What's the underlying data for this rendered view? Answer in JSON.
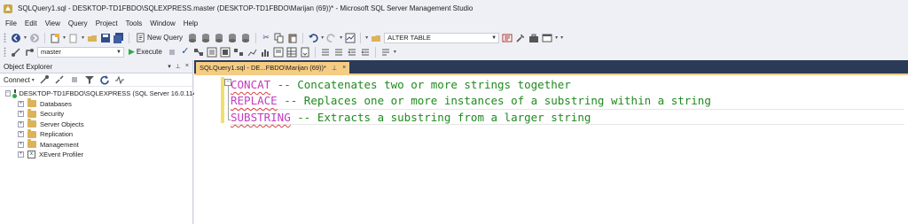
{
  "window": {
    "title": "SQLQuery1.sql - DESKTOP-TD1FBDO\\SQLEXPRESS.master (DESKTOP-TD1FBDO\\Marijan (69))* - Microsoft SQL Server Management Studio"
  },
  "menu": [
    "File",
    "Edit",
    "View",
    "Query",
    "Project",
    "Tools",
    "Window",
    "Help"
  ],
  "toolbar": {
    "new_query_label": "New Query",
    "alter_table_label": "ALTER TABLE",
    "database_value": "master",
    "execute_label": "Execute"
  },
  "object_explorer": {
    "title": "Object Explorer",
    "header_buttons": [
      "▾",
      "⊥",
      "×"
    ],
    "connect_label": "Connect",
    "server_label": "DESKTOP-TD1FBDO\\SQLEXPRESS (SQL Server 16.0.114",
    "nodes": [
      "Databases",
      "Security",
      "Server Objects",
      "Replication",
      "Management",
      "XEvent Profiler"
    ]
  },
  "editor": {
    "tab_title": "SQLQuery1.sql - DE...FBDO\\Marijan (69))*",
    "tab_pin": "⊥",
    "tab_close": "×",
    "lines": [
      {
        "keyword": "CONCAT",
        "comment": " -- Concatenates two or more strings together"
      },
      {
        "keyword": "REPLACE",
        "comment": " -- Replaces one or more instances of a substring within a string"
      },
      {
        "keyword": "SUBSTRING",
        "comment": " -- Extracts a substring from a larger string"
      }
    ]
  },
  "colors": {
    "keyword": "#c13cc1",
    "comment": "#1f8a1f",
    "tab_active": "#f5cc84",
    "editor_frame": "#293955"
  }
}
